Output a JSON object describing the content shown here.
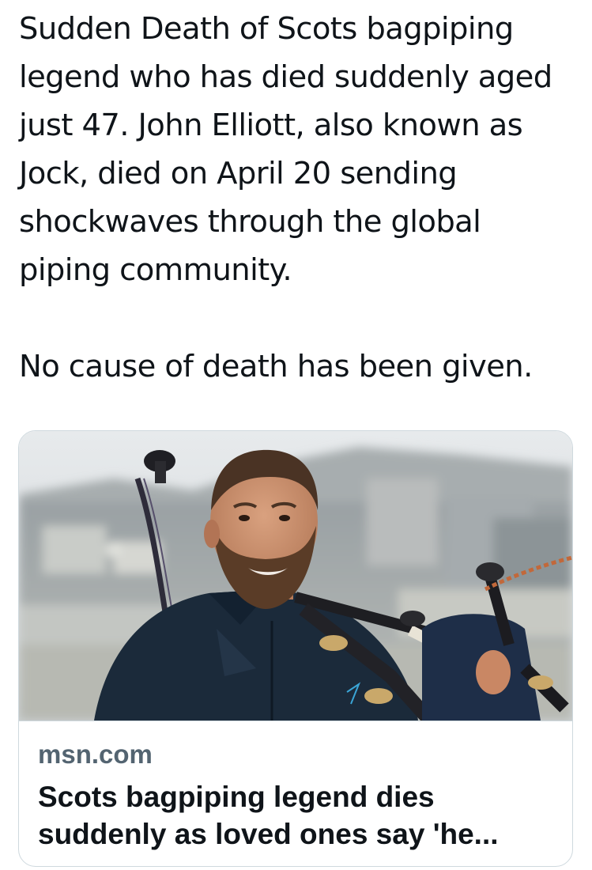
{
  "tweet": {
    "paragraph_1": "Sudden Death of Scots bagpiping legend who has died suddenly aged just 47. John Elliott, also known as Jock, died on April 20 sending shockwaves through the global piping community.",
    "paragraph_2": "No cause of death has been given."
  },
  "link_card": {
    "domain": "msn.com",
    "title": "Scots bagpiping legend dies suddenly as loved ones say 'he..."
  },
  "colors": {
    "text": "#0f1419",
    "secondary_text": "#536471",
    "card_border": "#cfd9de",
    "background": "#ffffff"
  }
}
